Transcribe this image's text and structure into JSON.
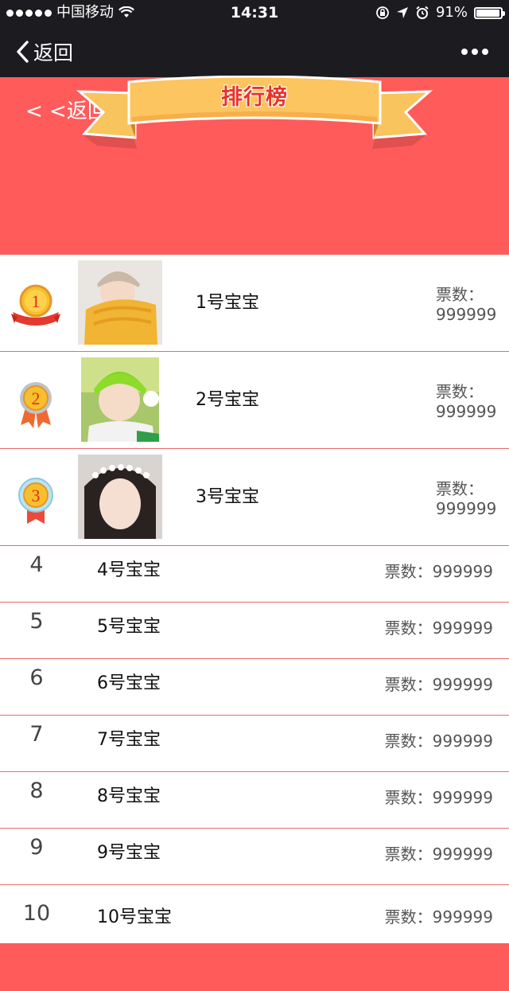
{
  "status_bar": {
    "carrier": "中国移动",
    "time": "14:31",
    "battery_text": "91%",
    "battery_level": 0.91,
    "wifi_icon": "wifi-icon",
    "lock_icon": "rotation-lock-icon",
    "location_icon": "location-arrow-icon",
    "alarm_icon": "alarm-icon"
  },
  "nav": {
    "back_label": "返回",
    "more_icon": "more-dots-icon"
  },
  "banner": {
    "back_link": "< <返回",
    "title": "排行榜",
    "bg_color": "#ff5b5b"
  },
  "top3": [
    {
      "rank_badge": "1",
      "name": "1号宝宝",
      "votes_label": "票数：",
      "votes": "999999"
    },
    {
      "rank_badge": "2",
      "name": "2号宝宝",
      "votes_label": "票数：",
      "votes": "999999"
    },
    {
      "rank_badge": "3",
      "name": "3号宝宝",
      "votes_label": "票数：",
      "votes": "999999"
    }
  ],
  "others": [
    {
      "rank": "4",
      "name": "4号宝宝",
      "votes": "票数：999999"
    },
    {
      "rank": "5",
      "name": "5号宝宝",
      "votes": "票数：999999"
    },
    {
      "rank": "6",
      "name": "6号宝宝",
      "votes": "票数：999999"
    },
    {
      "rank": "7",
      "name": "7号宝宝",
      "votes": "票数：999999"
    },
    {
      "rank": "8",
      "name": "8号宝宝",
      "votes": "票数：999999"
    },
    {
      "rank": "9",
      "name": "9号宝宝",
      "votes": "票数：999999"
    },
    {
      "rank": "10",
      "name": "10号宝宝",
      "votes": "票数：999999"
    }
  ]
}
